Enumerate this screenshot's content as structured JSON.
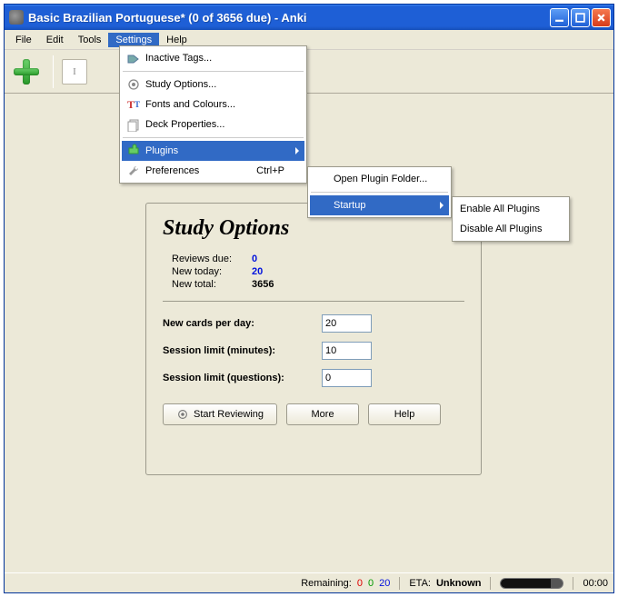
{
  "titlebar": {
    "title": "Basic Brazilian Portuguese* (0 of 3656 due) - Anki"
  },
  "menubar": {
    "items": [
      "File",
      "Edit",
      "Tools",
      "Settings",
      "Help"
    ],
    "open_index": 3
  },
  "settings_menu": {
    "inactive_tags": "Inactive Tags...",
    "study_options": "Study Options...",
    "fonts_colours": "Fonts and Colours...",
    "deck_properties": "Deck Properties...",
    "plugins": "Plugins",
    "preferences": "Preferences",
    "preferences_shortcut": "Ctrl+P"
  },
  "plugins_menu": {
    "open_folder": "Open Plugin Folder...",
    "startup": "Startup"
  },
  "startup_menu": {
    "enable_all": "Enable All Plugins",
    "disable_all": "Disable All Plugins"
  },
  "panel": {
    "heading": "Study Options",
    "stats": {
      "reviews_due_label": "Reviews due:",
      "reviews_due_value": "0",
      "new_today_label": "New today:",
      "new_today_value": "20",
      "new_total_label": "New total:",
      "new_total_value": "3656"
    },
    "form": {
      "new_cards_label": "New cards per day:",
      "new_cards_value": "20",
      "session_min_label": "Session limit (minutes):",
      "session_min_value": "10",
      "session_q_label": "Session limit (questions):",
      "session_q_value": "0"
    },
    "buttons": {
      "start": "Start Reviewing",
      "more": "More",
      "help": "Help"
    }
  },
  "statusbar": {
    "remaining_label": "Remaining:",
    "remaining_red": "0",
    "remaining_green": "0",
    "remaining_blue": "20",
    "eta_label": "ETA:",
    "eta_value": "Unknown",
    "clock": "00:00"
  },
  "toolbar": {
    "text_indicator": "I"
  }
}
